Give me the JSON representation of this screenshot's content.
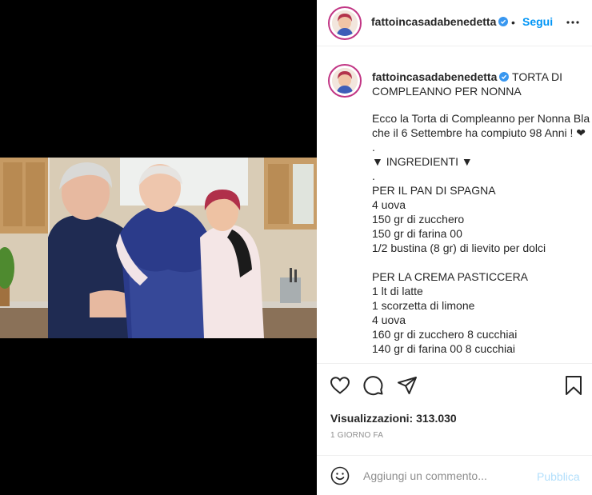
{
  "header": {
    "username": "fattoincasadabenedetta",
    "separator": "•",
    "follow_label": "Segui"
  },
  "caption": {
    "username": "fattoincasadabenedetta",
    "title": "TORTA DI COMPLEANNO PER NONNA",
    "lines": [
      "Ecco la Torta di Compleanno per Nonna Bla",
      "che il 6 Settembre ha compiuto 98 Anni ! ❤",
      ".",
      "▼ INGREDIENTI ▼",
      ".",
      "PER IL PAN DI SPAGNA",
      "4 uova",
      "150 gr di zucchero",
      "150 gr di farina 00",
      "1/2 bustina (8 gr) di lievito per dolci",
      "",
      "PER LA CREMA PASTICCERA",
      "1 lt di latte",
      "1 scorzetta di limone",
      "4 uova",
      "160 gr di zucchero 8 cucchiai",
      "140 gr di farina 00 8 cucchiai"
    ]
  },
  "stats": {
    "views_label": "Visualizzazioni:",
    "views_count": "313.030",
    "time_ago": "1 GIORNO FA"
  },
  "comment": {
    "placeholder": "Aggiungi un commento...",
    "publish_label": "Pubblica"
  },
  "icons": {
    "like": "heart-icon",
    "comment": "comment-icon",
    "share": "paper-plane-icon",
    "save": "bookmark-icon",
    "more": "more-icon",
    "emoji": "emoji-icon",
    "verified": "verified-badge-icon"
  },
  "colors": {
    "accent": "#0095f6",
    "publish_disabled": "#b2dffc",
    "story_ring": "#c13584"
  }
}
